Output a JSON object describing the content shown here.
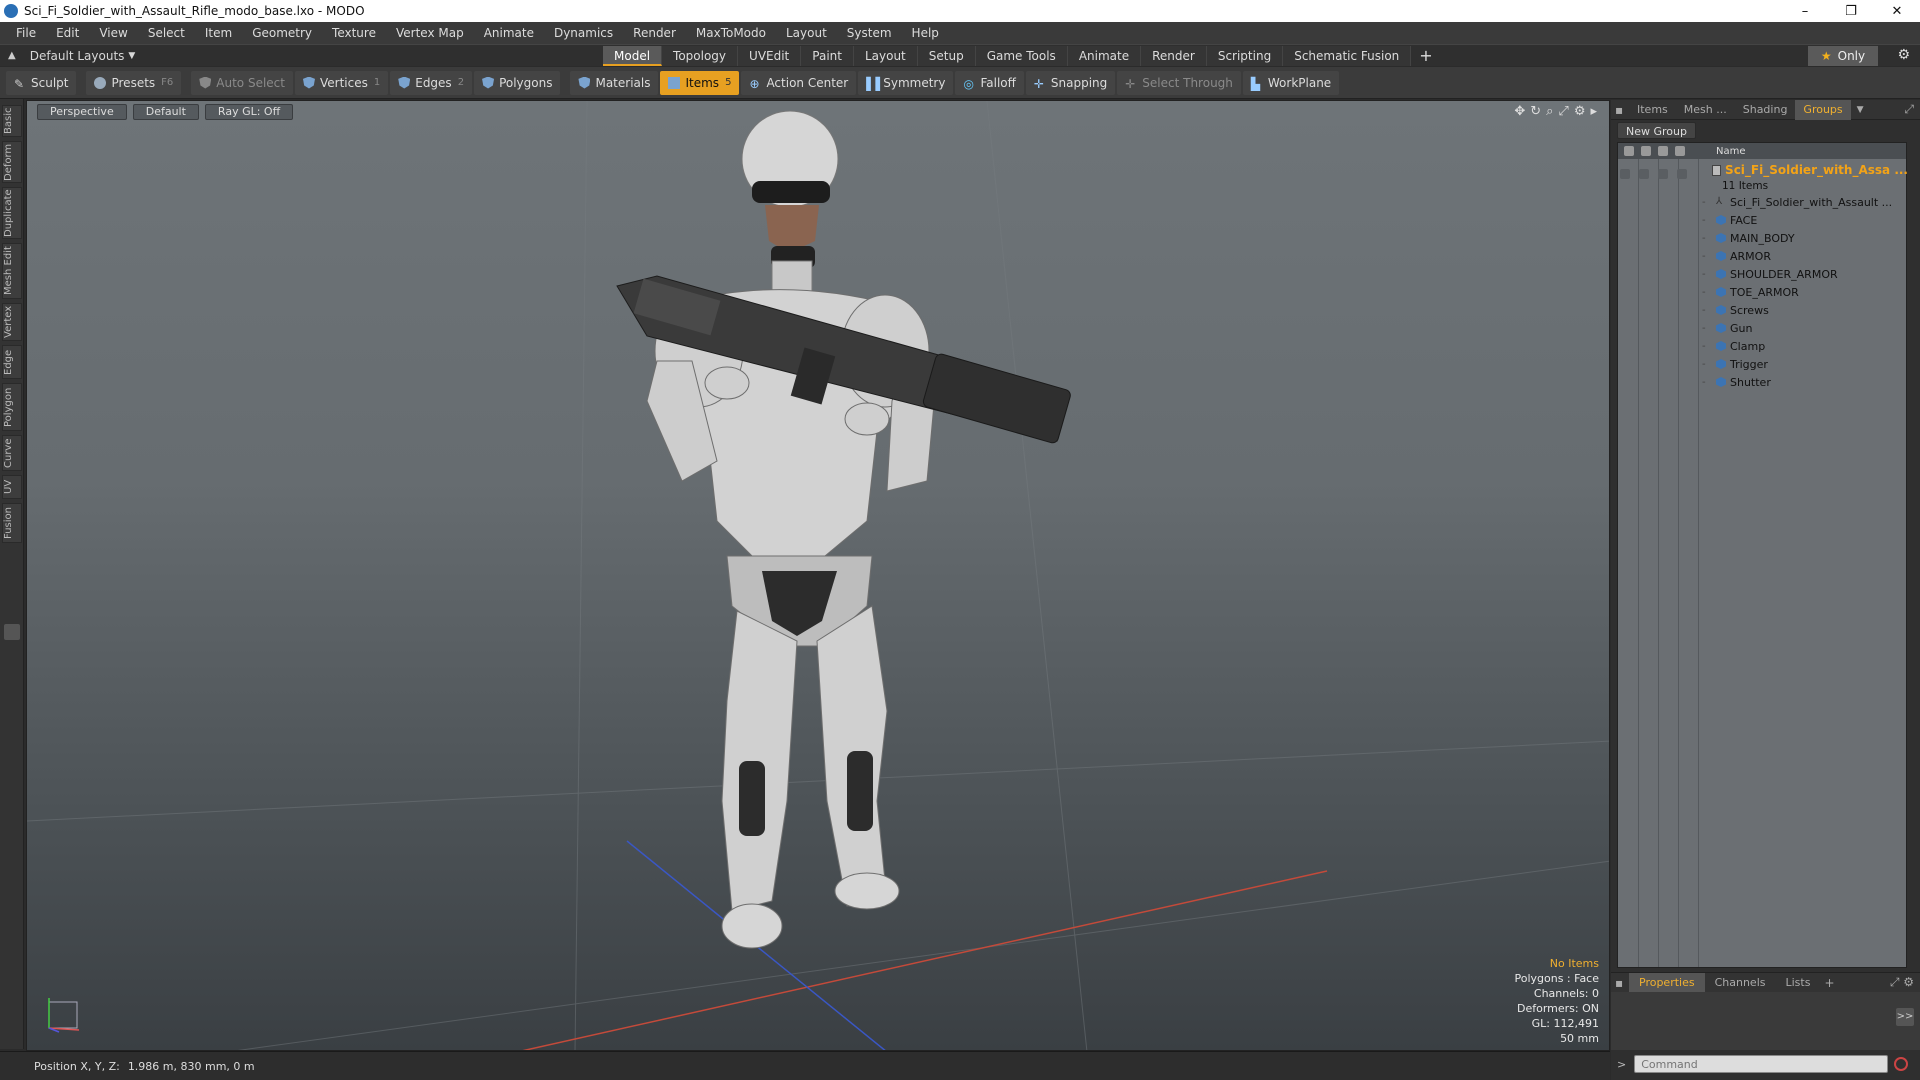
{
  "window": {
    "title": "Sci_Fi_Soldier_with_Assault_Rifle_modo_base.lxo - MODO",
    "controls": {
      "minimize": "–",
      "maximize": "❐",
      "close": "✕"
    }
  },
  "menu": [
    "File",
    "Edit",
    "View",
    "Select",
    "Item",
    "Geometry",
    "Texture",
    "Vertex Map",
    "Animate",
    "Dynamics",
    "Render",
    "MaxToModo",
    "Layout",
    "System",
    "Help"
  ],
  "layoutbar": {
    "layout_name": "Default Layouts",
    "tabs": [
      "Model",
      "Topology",
      "UVEdit",
      "Paint",
      "Layout",
      "Setup",
      "Game Tools",
      "Animate",
      "Render",
      "Scripting",
      "Schematic Fusion"
    ],
    "active_tab": "Model",
    "only_label": "Only"
  },
  "toolbar": {
    "sculpt": "Sculpt",
    "presets": "Presets",
    "presets_key": "F6",
    "auto_select": "Auto Select",
    "vertices": "Vertices",
    "vertices_key": "1",
    "edges": "Edges",
    "edges_key": "2",
    "polygons": "Polygons",
    "materials": "Materials",
    "items": "Items",
    "items_key": "5",
    "action_center": "Action Center",
    "symmetry": "Symmetry",
    "falloff": "Falloff",
    "snapping": "Snapping",
    "select_through": "Select Through",
    "workplane": "WorkPlane"
  },
  "left_tabs": [
    "Basic",
    "Deform",
    "Duplicate",
    "Mesh Edit",
    "Vertex",
    "Edge",
    "Polygon",
    "Curve",
    "UV",
    "Fusion"
  ],
  "viewport": {
    "view_mode": "Perspective",
    "shading": "Default",
    "raygl": "Ray GL: Off",
    "stats": {
      "selection": "No Items",
      "polygons": "Polygons : Face",
      "channels": "Channels: 0",
      "deformers": "Deformers: ON",
      "gl": "GL: 112,491",
      "scale": "50 mm"
    }
  },
  "statusbar": {
    "position_label": "Position X, Y, Z:",
    "position_value": "1.986 m, 830 mm, 0 m"
  },
  "right_panel": {
    "tabs": [
      "Items",
      "Mesh ...",
      "Shading",
      "Groups"
    ],
    "active_tab": "Groups",
    "new_group": "New Group",
    "name_header": "Name",
    "group_name": "Sci_Fi_Soldier_with_Assa ...",
    "item_count": "11 Items",
    "items": [
      {
        "name": "Sci_Fi_Soldier_with_Assault ...",
        "kind": "locator"
      },
      {
        "name": "FACE",
        "kind": "mesh"
      },
      {
        "name": "MAIN_BODY",
        "kind": "mesh"
      },
      {
        "name": "ARMOR",
        "kind": "mesh"
      },
      {
        "name": "SHOULDER_ARMOR",
        "kind": "mesh"
      },
      {
        "name": "TOE_ARMOR",
        "kind": "mesh"
      },
      {
        "name": "Screws",
        "kind": "mesh"
      },
      {
        "name": "Gun",
        "kind": "mesh"
      },
      {
        "name": "Clamp",
        "kind": "mesh"
      },
      {
        "name": "Trigger",
        "kind": "mesh"
      },
      {
        "name": "Shutter",
        "kind": "mesh"
      }
    ],
    "bottom_tabs": [
      "Properties",
      "Channels",
      "Lists"
    ],
    "bottom_active": "Properties",
    "command_placeholder": "Command"
  },
  "colors": {
    "accent": "#e7a021",
    "group_text": "#f3a317",
    "mesh_icon": "#3c74b3"
  }
}
